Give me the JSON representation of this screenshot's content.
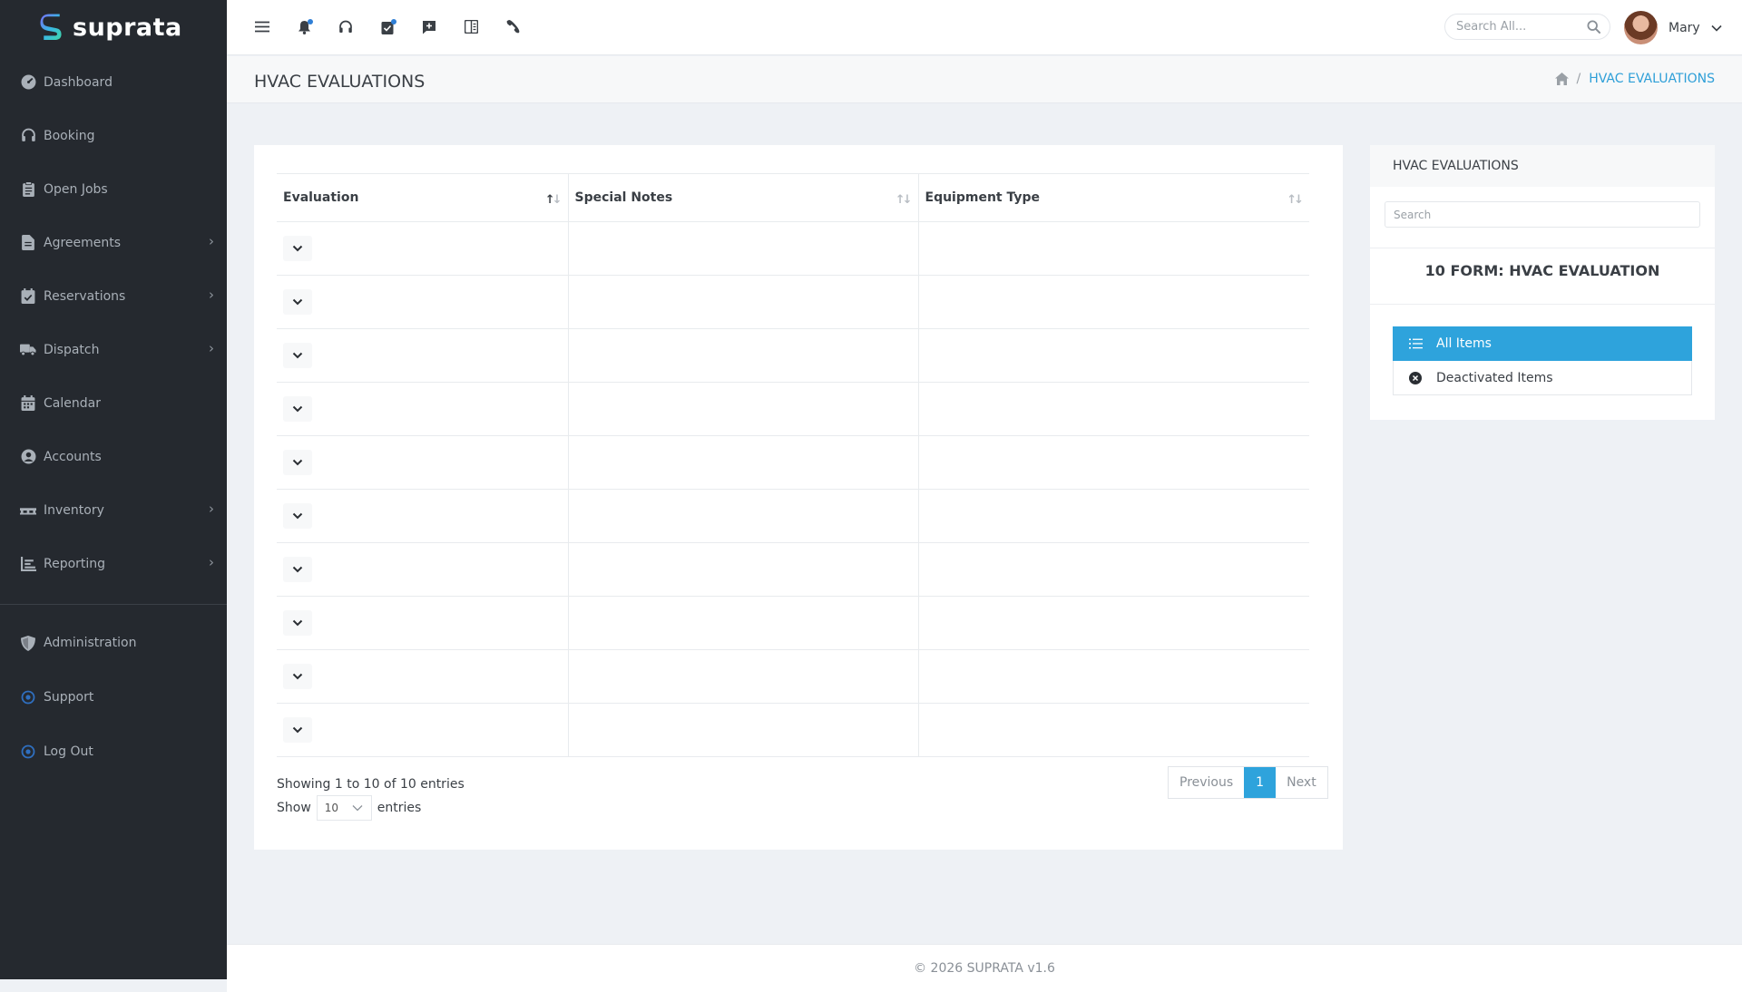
{
  "app": {
    "logo_text": "suprata"
  },
  "sidebar": {
    "items": [
      {
        "label": "Dashboard",
        "icon": "dashboard-icon"
      },
      {
        "label": "Booking",
        "icon": "headset-icon"
      },
      {
        "label": "Open Jobs",
        "icon": "clipboard-icon"
      },
      {
        "label": "Agreements",
        "icon": "file-icon",
        "has_children": true
      },
      {
        "label": "Reservations",
        "icon": "calendar-check-icon",
        "has_children": true
      },
      {
        "label": "Dispatch",
        "icon": "truck-icon",
        "has_children": true
      },
      {
        "label": "Calendar",
        "icon": "calendar-icon"
      },
      {
        "label": "Accounts",
        "icon": "user-circle-icon"
      },
      {
        "label": "Inventory",
        "icon": "pallet-icon",
        "has_children": true
      },
      {
        "label": "Reporting",
        "icon": "chart-icon",
        "has_children": true
      }
    ],
    "bottom_items": [
      {
        "label": "Administration",
        "icon": "shield-icon"
      },
      {
        "label": "Support",
        "icon": "dot-circle-icon"
      },
      {
        "label": "Log Out",
        "icon": "dot-circle-icon"
      }
    ]
  },
  "topbar": {
    "search_placeholder": "Search All...",
    "user_name": "Mary"
  },
  "page": {
    "title": "HVAC EVALUATIONS",
    "breadcrumb_current": "HVAC EVALUATIONS"
  },
  "table": {
    "columns": [
      "Evaluation",
      "Special Notes",
      "Equipment Type"
    ],
    "rows": [
      [
        "",
        "",
        ""
      ],
      [
        "",
        "",
        ""
      ],
      [
        "",
        "",
        ""
      ],
      [
        "",
        "",
        ""
      ],
      [
        "",
        "",
        ""
      ],
      [
        "",
        "",
        ""
      ],
      [
        "",
        "",
        ""
      ],
      [
        "",
        "",
        ""
      ],
      [
        "",
        "",
        ""
      ],
      [
        "",
        "",
        ""
      ]
    ],
    "info": "Showing 1 to 10 of 10 entries",
    "show_label": "Show",
    "page_length": "10",
    "entries_label": "entries",
    "pagination": {
      "previous": "Previous",
      "current": "1",
      "next": "Next"
    }
  },
  "panel": {
    "header": "HVAC EVALUATIONS",
    "search_placeholder": "Search",
    "form_label": "10 FORM: HVAC EVALUATION",
    "items": [
      {
        "label": "All Items",
        "active": true
      },
      {
        "label": "Deactivated Items",
        "active": false
      }
    ]
  },
  "footer": {
    "text": "© 2026 SUPRATA v1.6"
  },
  "colors": {
    "accent": "#2ea3dc",
    "sidebar_bg": "#25292f",
    "notify_dot": "#2f7fd6"
  }
}
